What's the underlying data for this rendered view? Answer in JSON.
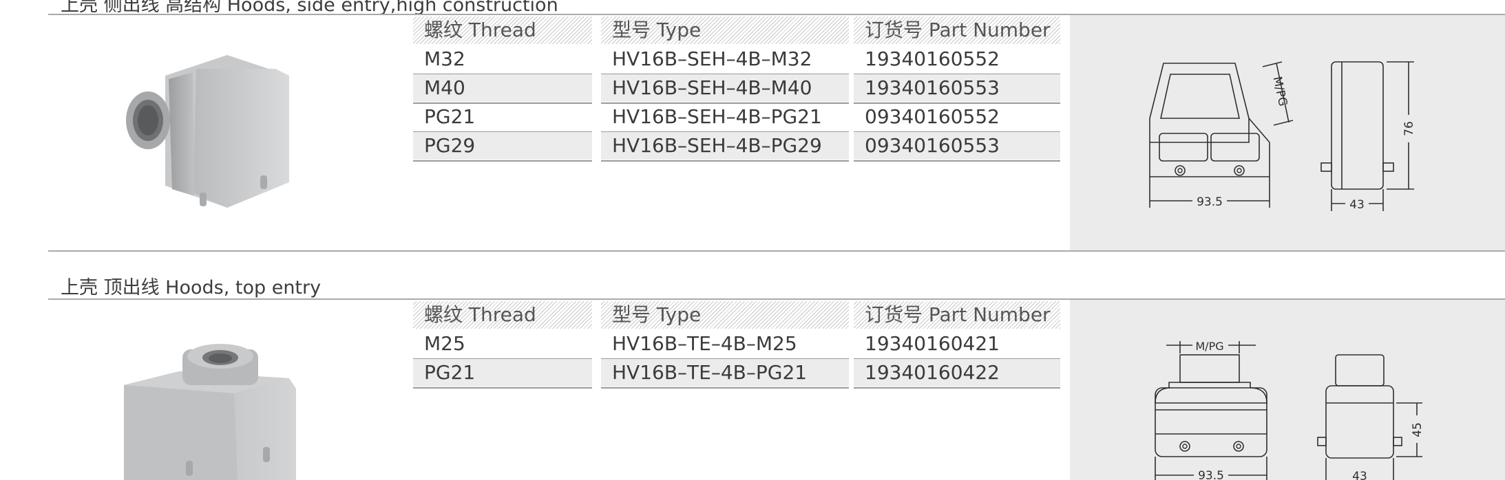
{
  "section1": {
    "title": "上壳 侧出线 高结构  Hoods, side entry,high construction",
    "headers": {
      "thread": "螺纹 Thread",
      "type": "型号 Type",
      "part": "订货号 Part Number"
    },
    "rows": [
      {
        "thread": "M32",
        "type": "HV16B–SEH–4B–M32",
        "part": "19340160552"
      },
      {
        "thread": "M40",
        "type": "HV16B–SEH–4B–M40",
        "part": "19340160553"
      },
      {
        "thread": "PG21",
        "type": "HV16B–SEH–4B–PG21",
        "part": "09340160552"
      },
      {
        "thread": "PG29",
        "type": "HV16B–SEH–4B–PG29",
        "part": "09340160553"
      }
    ],
    "drawing": {
      "width_label": "93.5",
      "depth_label": "43",
      "height_label": "76",
      "entry_label": "M/PG"
    }
  },
  "section2": {
    "title": "上壳 顶出线  Hoods, top entry",
    "headers": {
      "thread": "螺纹 Thread",
      "type": "型号 Type",
      "part": "订货号 Part Number"
    },
    "rows": [
      {
        "thread": "M25",
        "type": "HV16B–TE–4B–M25",
        "part": "19340160421"
      },
      {
        "thread": "PG21",
        "type": "HV16B–TE–4B–PG21",
        "part": "19340160422"
      }
    ],
    "drawing": {
      "width_label": "93.5",
      "depth_label": "43",
      "height_label": "45",
      "entry_label": "M/PG"
    }
  }
}
